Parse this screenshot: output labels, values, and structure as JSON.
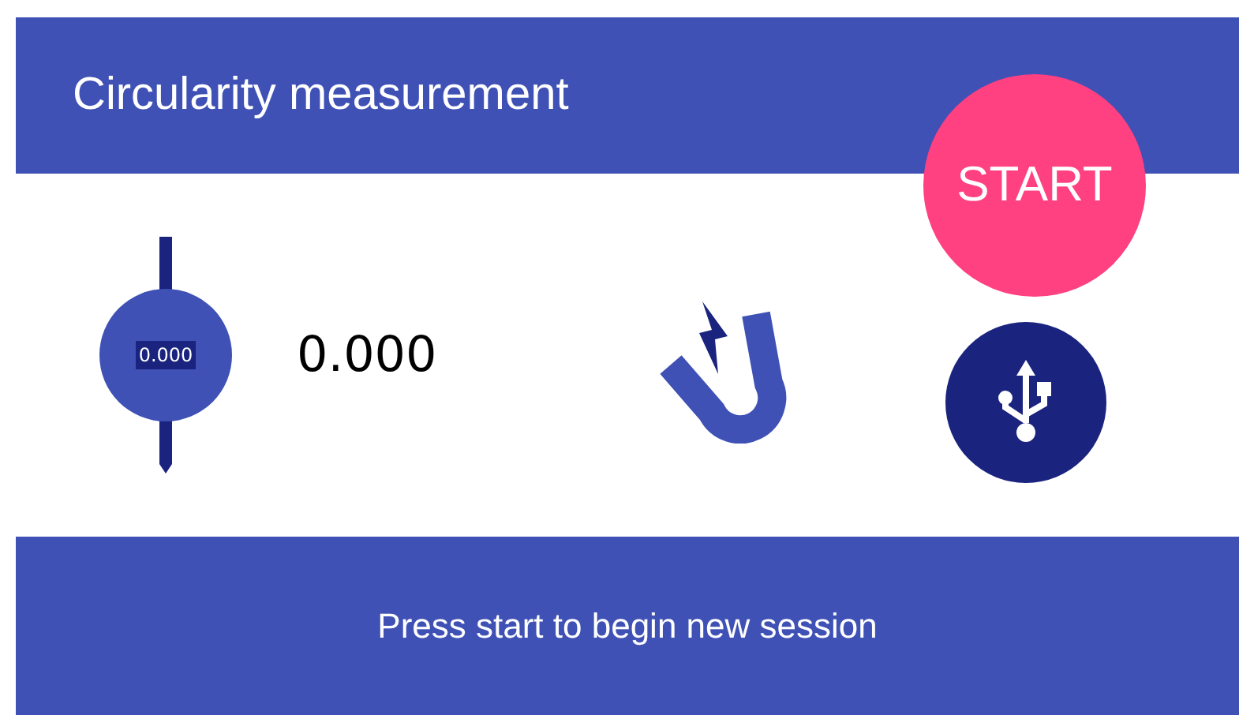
{
  "header": {
    "title": "Circularity measurement"
  },
  "gauge": {
    "display": "0.000"
  },
  "reading": "0.000",
  "start_button": {
    "label": "START"
  },
  "status_bar": {
    "message": "Press start to begin new session"
  }
}
